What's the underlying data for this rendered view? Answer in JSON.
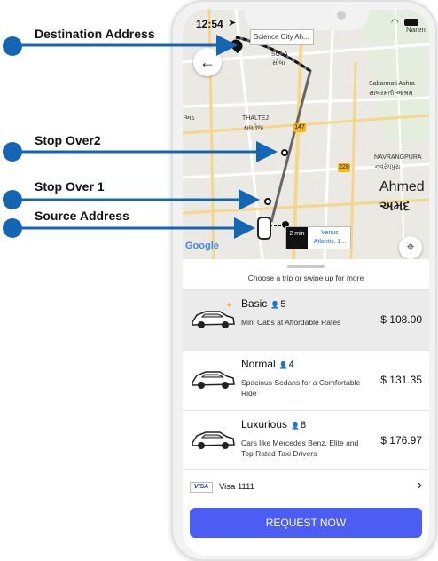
{
  "annotations": [
    {
      "label": "Destination Address"
    },
    {
      "label": "Stop Over2"
    },
    {
      "label": "Stop Over 1"
    },
    {
      "label": "Source Address"
    }
  ],
  "status_bar": {
    "time": "12:54",
    "time_arrow": "➤"
  },
  "map": {
    "destination_tag": "Science City Ah...",
    "eta_time": "2 min",
    "eta_place": "Venus Atlantis, 1...",
    "place_labels": [
      "SOLA",
      "સોલા",
      "Sabarmati Ashra",
      "સાબરમતી આશ્રમ",
      "THALTEJ",
      "થલતેજ",
      "NAVRANGPURA",
      "નવરંગપુરા",
      "Ahmed",
      "અમદ",
      "Naren",
      "અડ"
    ],
    "road_badges": [
      "147",
      "228"
    ],
    "google": "Google"
  },
  "sheet": {
    "hint": "Choose a trip or swipe up for more",
    "rides": [
      {
        "name": "Basic",
        "seats": "5",
        "desc": "Mini Cabs at Affordable Rates",
        "price": "$ 108.00"
      },
      {
        "name": "Normal",
        "seats": "4",
        "desc": "Spacious Sedans for a Comfortable Ride",
        "price": "$ 131.35"
      },
      {
        "name": "Luxurious",
        "seats": "8",
        "desc": "Cars like Mercedes Benz, Elite and Top Rated Taxi Drivers",
        "price": "$ 176.97"
      }
    ],
    "payment": {
      "card_brand": "VISA",
      "label": "Visa 1111"
    },
    "request_button": "REQUEST NOW"
  },
  "colors": {
    "accent": "#4b5df2",
    "annotation": "#1466b4",
    "route": "#666666"
  }
}
